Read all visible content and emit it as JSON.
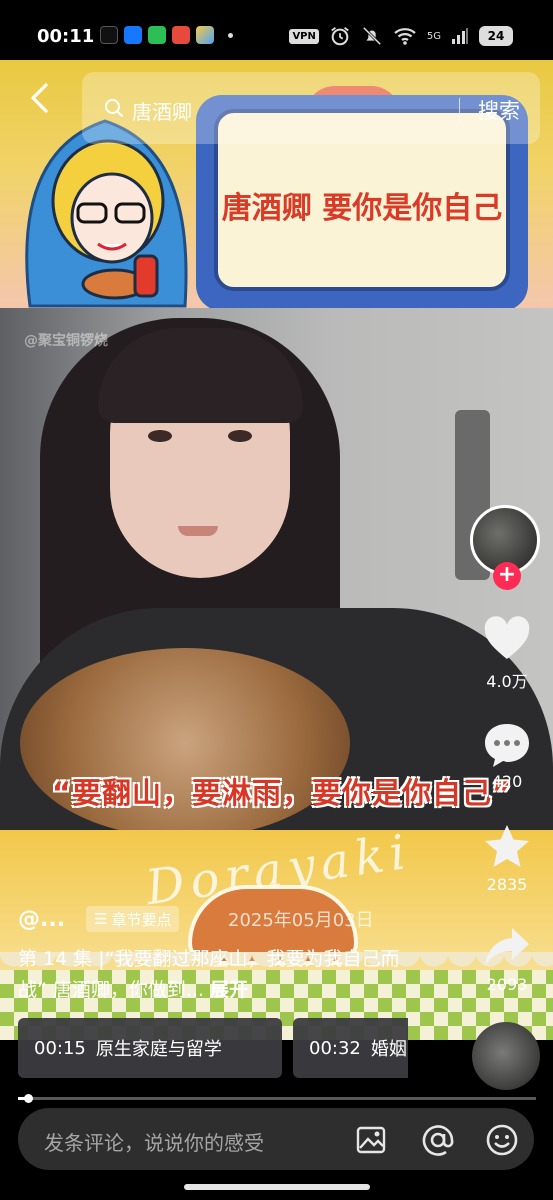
{
  "status_bar": {
    "time": "00:11",
    "vpn": "VPN",
    "network": "5G",
    "battery": "24"
  },
  "search": {
    "query": "唐酒卿",
    "button_label": "搜索"
  },
  "banner": {
    "tv_title": "唐酒卿 要你是你自己"
  },
  "video": {
    "watermark": "@聚宝铜锣烧",
    "subtitle": "“要翻山，要淋雨，要你是你自己”"
  },
  "bottom_banner": {
    "logo_text": "Dorayaki"
  },
  "post": {
    "author": "@...",
    "chapter_label": "章节要点",
    "date": "2025年05月03日",
    "description": "第 14 集 |“我要翻过那座山，我要为我自己而战” 唐酒卿，你做到...",
    "expand_label": "展开"
  },
  "chapters": [
    {
      "time": "00:15",
      "title": "原生家庭与留学"
    },
    {
      "time": "00:32",
      "title": "婚姻"
    }
  ],
  "actions": {
    "likes": "4.0万",
    "comments": "420",
    "favorites": "2835",
    "shares": "2093"
  },
  "progress": {
    "fraction": 0.02
  },
  "comment_bar": {
    "placeholder": "发条评论，说说你的感受"
  },
  "colors": {
    "follow_accent": "#fe2c55",
    "subtitle_red": "#d73725",
    "tv_blue": "#3d66c0"
  }
}
